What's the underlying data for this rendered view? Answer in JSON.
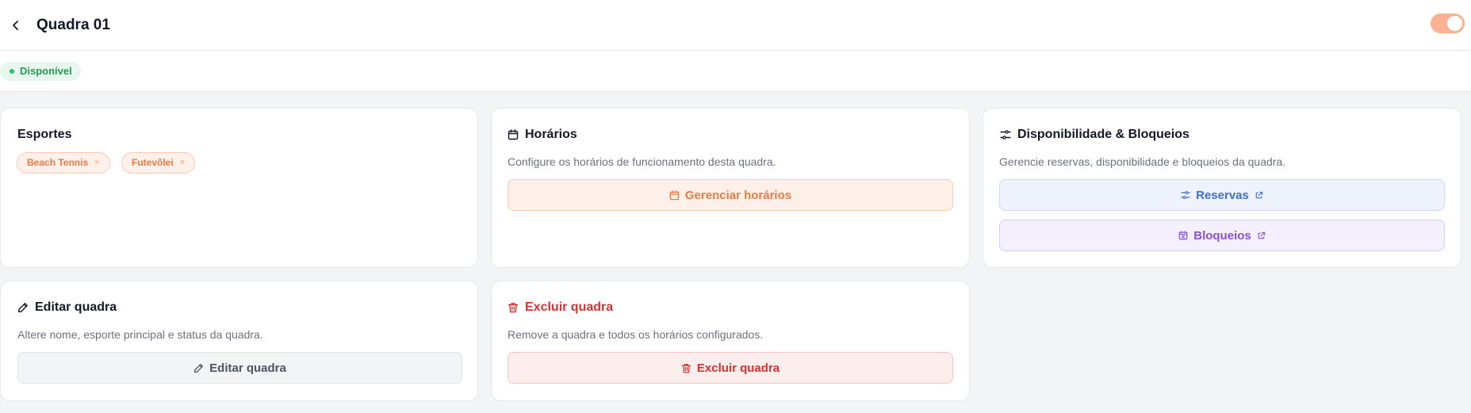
{
  "header": {
    "title": "Quadra 01",
    "back_icon": "chevron-left-icon",
    "toggle_state": "on",
    "toggle_color": "#fbb294"
  },
  "status": {
    "label": "Disponível",
    "color": "#22c55e"
  },
  "sports_card": {
    "title": "Esportes",
    "chips": [
      {
        "label": "Beach Tennis",
        "remove": "×"
      },
      {
        "label": "Futevôlei",
        "remove": "×"
      }
    ]
  },
  "schedule_card": {
    "title": "Horários",
    "icon": "calendar-icon",
    "description": "Configure os horários de funcionamento desta quadra.",
    "button_label": "Gerenciar horários",
    "accent": "#f0783e"
  },
  "availability_card": {
    "title": "Disponibilidade & Bloqueios",
    "icon": "sliders-icon",
    "description": "Gerencie reservas, disponibilidade e bloqueios da quadra.",
    "reservations_label": "Reservas",
    "blocks_label": "Bloqueios",
    "reservations_color": "#3b6fd8",
    "blocks_color": "#8a4fd3"
  },
  "edit_card": {
    "title": "Editar quadra",
    "icon": "pencil-icon",
    "description": "Altere nome, esporte principal e status da quadra.",
    "button_label": "Editar quadra"
  },
  "delete_card": {
    "title": "Excluir quadra",
    "icon": "trash-icon",
    "description": "Remove a quadra e todos os horários configurados.",
    "button_label": "Excluir quadra",
    "accent": "#dc2f2f"
  }
}
